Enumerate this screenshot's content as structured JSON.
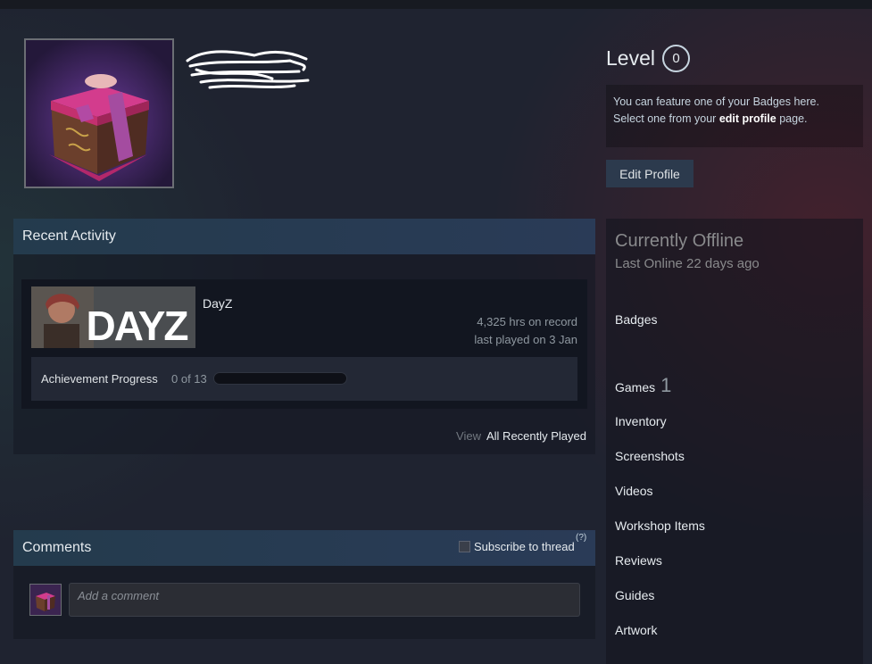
{
  "level": {
    "label": "Level",
    "value": "0"
  },
  "badge_box": {
    "line1": "You can feature one of your Badges here.",
    "line2_prefix": "Select one from your",
    "line2_link": "edit profile",
    "line2_suffix": "page."
  },
  "edit_profile_label": "Edit Profile",
  "recent_activity": {
    "title": "Recent Activity",
    "game": {
      "name": "DayZ",
      "capsule_text": "DAYZ",
      "hours": "4,325 hrs on record",
      "last_played": "last played on 3 Jan",
      "achievement_label": "Achievement Progress",
      "achievement_count": "0 of 13",
      "achievement_progress": 0
    },
    "view_label": "View",
    "all_recently_played": "All Recently Played"
  },
  "comments": {
    "title": "Comments",
    "subscribe_label": "Subscribe to thread",
    "help_label": "(?)",
    "placeholder": "Add a comment"
  },
  "status": {
    "title": "Currently Offline",
    "last_online": "Last Online 22 days ago"
  },
  "side_links": {
    "badges": "Badges",
    "games": "Games",
    "games_count": "1",
    "inventory": "Inventory",
    "screenshots": "Screenshots",
    "videos": "Videos",
    "workshop": "Workshop Items",
    "reviews": "Reviews",
    "guides": "Guides",
    "artwork": "Artwork"
  },
  "colors": {
    "background": "#1f2330",
    "header_gradient_start": "#243b4d",
    "header_gradient_end": "#2a3b57",
    "button": "#2c3a4d",
    "avatar_box": "#b52a6a"
  }
}
